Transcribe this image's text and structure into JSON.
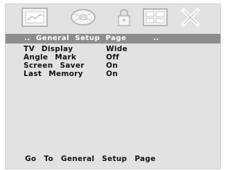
{
  "icons": {
    "setup": "general-setup-icon",
    "audio": "audio-setup-icon",
    "lock": "lock-icon",
    "preference": "preference-icon",
    "exit": "exit-icon"
  },
  "title": {
    "dots_left": "..",
    "text": "General Setup Page",
    "dots_right": ".."
  },
  "menu": {
    "items": [
      {
        "label": "TV Display",
        "value": "Wide"
      },
      {
        "label": "Angle Mark",
        "value": "Off"
      },
      {
        "label": "Screen Saver",
        "value": "On"
      },
      {
        "label": "Last Memory",
        "value": "On"
      }
    ]
  },
  "status": {
    "text": "Go To General Setup Page"
  },
  "colors": {
    "panel": "#e2e2e2",
    "titlebar": "#8d8d8d",
    "icon": "#ffffff"
  }
}
